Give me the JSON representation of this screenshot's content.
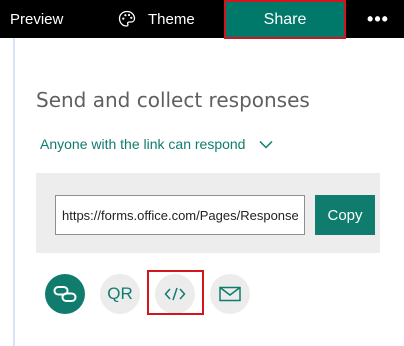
{
  "toolbar": {
    "preview_label": "Preview",
    "theme_label": "Theme",
    "share_label": "Share",
    "more_label": "•••"
  },
  "panel": {
    "title": "Send and collect responses",
    "permission_label": "Anyone with the link can respond",
    "link_url": "https://forms.office.com/Pages/ResponsePage.aspx",
    "copy_label": "Copy"
  },
  "share_options": {
    "qr_label": "QR",
    "embed_label": "</>",
    "icons": [
      "link-icon",
      "qr-code",
      "embed-icon",
      "email-icon"
    ]
  },
  "colors": {
    "accent": "#0f7c6e",
    "topbar": "#000000",
    "highlight": "#d4151d",
    "option_bg": "#ececec"
  }
}
